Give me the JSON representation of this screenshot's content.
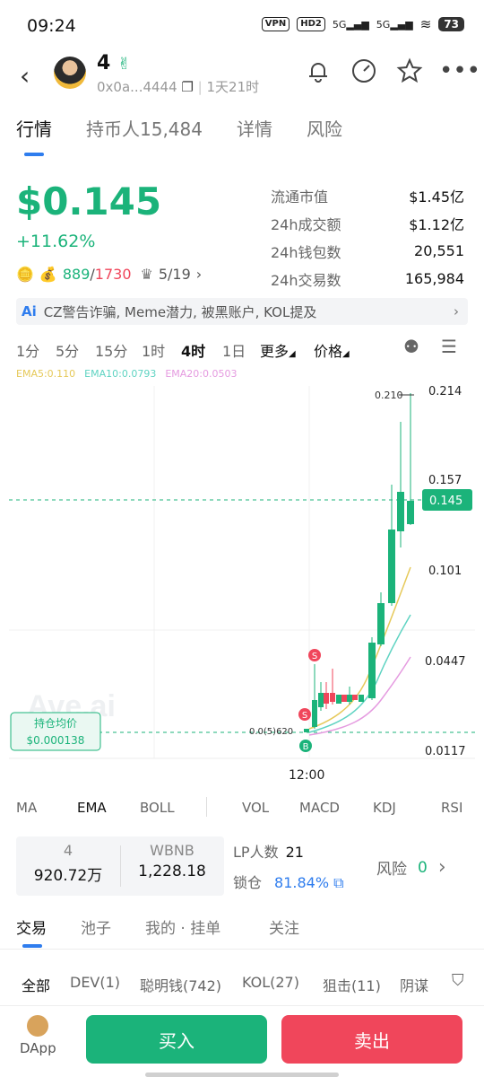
{
  "status": {
    "time": "09:24",
    "vpn": "VPN",
    "hd": "HD2",
    "net1": "5G",
    "net2": "5G",
    "battery": "73"
  },
  "header": {
    "token_name": "4",
    "address": "0x0a...4444",
    "age": "1天21时"
  },
  "tabs": [
    "行情",
    "持币人15,484",
    "详情",
    "风险"
  ],
  "price": {
    "value": "$0.145",
    "change": "+11.62%",
    "holders_num": "889",
    "holders_den": "1730",
    "rank": "5/19"
  },
  "stats": [
    {
      "label": "流通市值",
      "value": "$1.45亿"
    },
    {
      "label": "24h成交额",
      "value": "$1.12亿"
    },
    {
      "label": "24h钱包数",
      "value": "20,551"
    },
    {
      "label": "24h交易数",
      "value": "165,984"
    }
  ],
  "ai_bar": {
    "tag": "Ai",
    "text": "CZ警告诈骗, Meme潜力, 被黑账户, KOL提及"
  },
  "intervals": [
    "1分",
    "5分",
    "15分",
    "1时",
    "4时",
    "1日",
    "更多",
    "价格"
  ],
  "ema_legend": [
    {
      "text": "EMA5:0.110",
      "color": "#e6c95a"
    },
    {
      "text": "EMA10:0.0793",
      "color": "#5fd3c2"
    },
    {
      "text": "EMA20:0.0503",
      "color": "#e59be0"
    }
  ],
  "chart_data": {
    "type": "candlestick",
    "y_ticks": [
      "0.214",
      "0.157",
      "0.145",
      "0.101",
      "0.0447",
      "0.0117"
    ],
    "x_ticks": [
      "12:00"
    ],
    "current_price_label": "0.145",
    "high_label": "0.210",
    "low_label": "0.0(5)620",
    "avg_cost_label": "持仓均价",
    "avg_cost_value": "$0.000138",
    "watermark": "Ave.ai",
    "markers": [
      "S",
      "S",
      "B"
    ],
    "colors": {
      "up": "#1bb37a",
      "down": "#f0465b"
    }
  },
  "indicators": [
    "MA",
    "EMA",
    "BOLL",
    "VOL",
    "MACD",
    "KDJ",
    "RSI"
  ],
  "pool": {
    "sym1": "4",
    "val1": "920.72万",
    "sym2": "WBNB",
    "val2": "1,228.18",
    "lp_label": "LP人数",
    "lp_value": "21",
    "lock_label": "锁仓",
    "lock_value": "81.84%",
    "risk_label": "风险",
    "risk_value": "0"
  },
  "tabs2": [
    "交易",
    "池子",
    "我的 · 挂单",
    "关注"
  ],
  "filters": [
    "全部",
    "DEV(1)",
    "聪明钱(742)",
    "KOL(27)",
    "狙击(11)",
    "阴谋"
  ],
  "bottom": {
    "dapp": "DApp",
    "buy": "买入",
    "sell": "卖出"
  }
}
